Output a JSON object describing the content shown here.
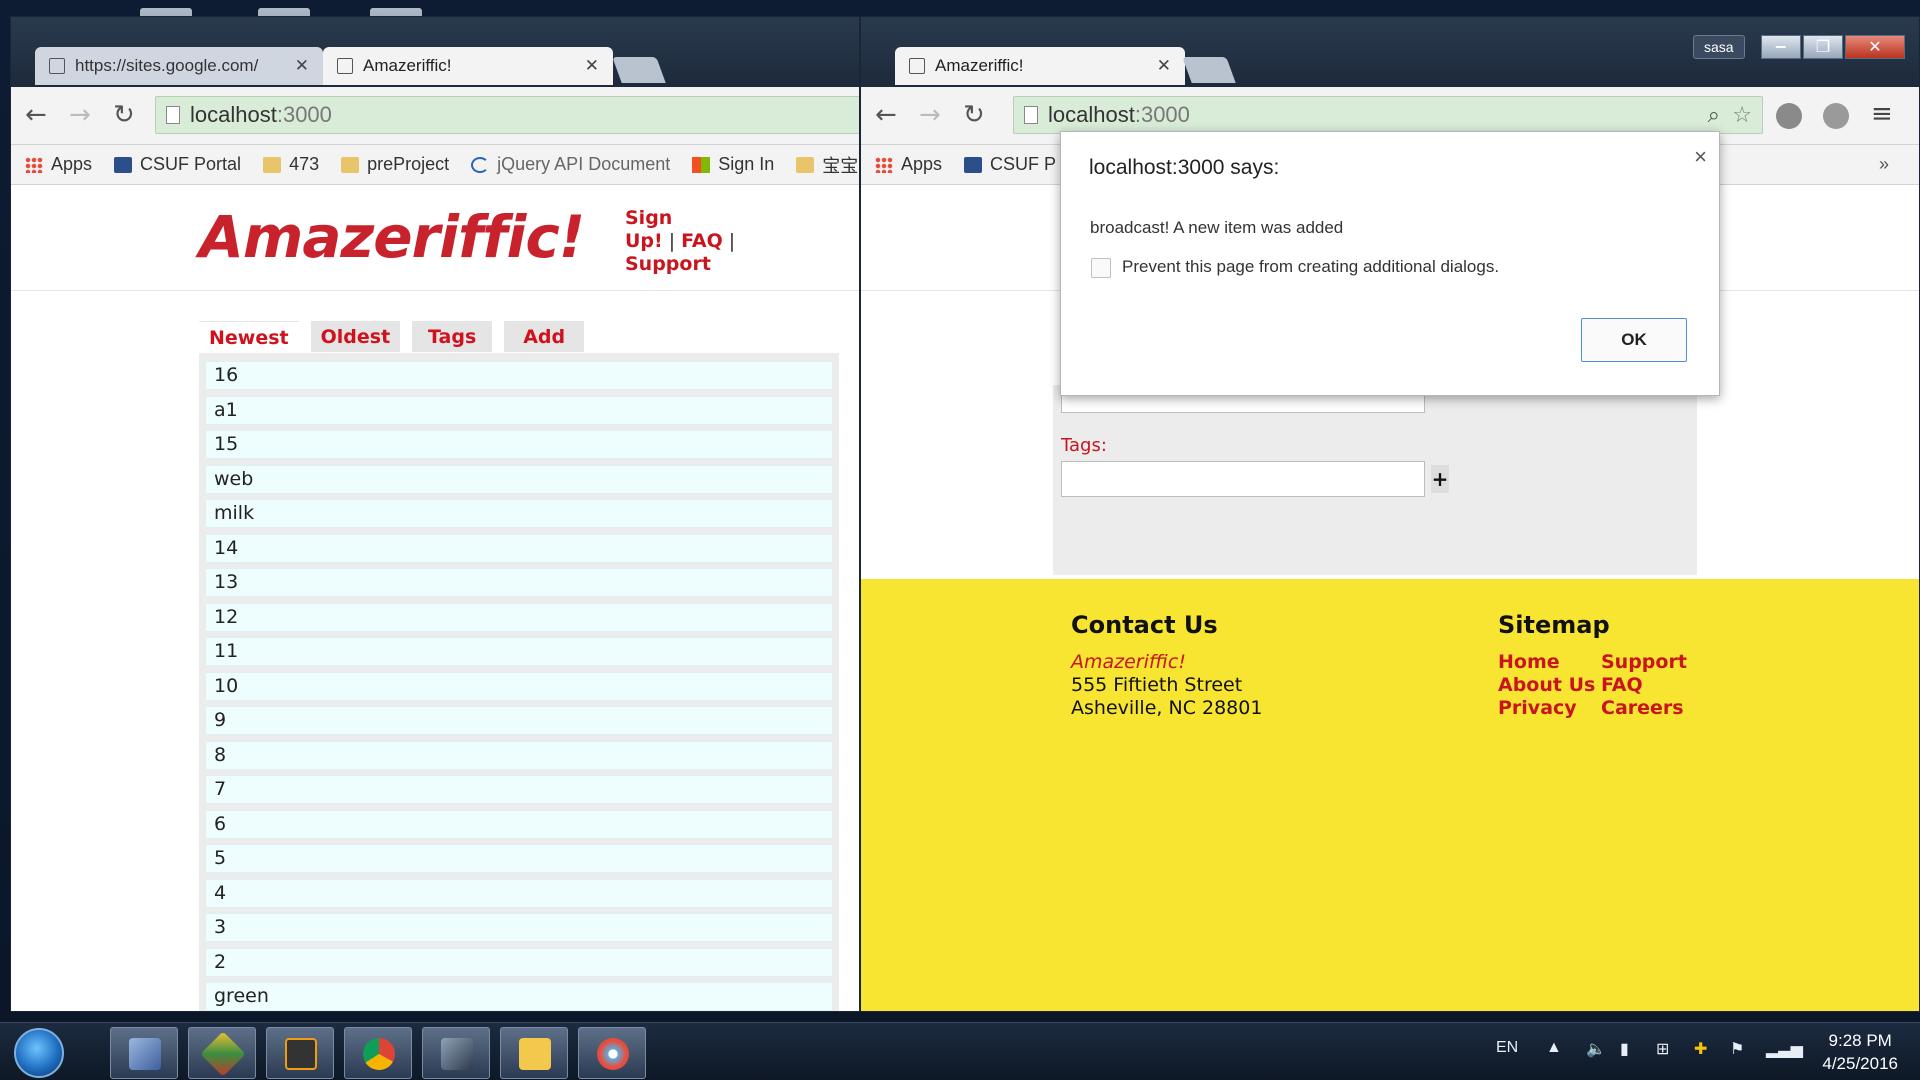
{
  "left_window": {
    "tabs": [
      {
        "title": "https://sites.google.com/",
        "active": false
      },
      {
        "title": "Amazeriffic!",
        "active": true
      }
    ],
    "url_host": "localhost",
    "url_port": ":3000",
    "bookmarks": [
      "Apps",
      "CSUF Portal",
      "473",
      "preProject",
      "jQuery API Document",
      "Sign In",
      "宝宝"
    ],
    "site": {
      "logo": "Amazeriffic!",
      "nav": {
        "signup": "Sign Up!",
        "faq": "FAQ",
        "support": "Support",
        "sep": "|"
      },
      "tabs": [
        "Newest",
        "Oldest",
        "Tags",
        "Add"
      ],
      "items": [
        "16",
        "a1",
        "15",
        "web",
        "milk",
        "14",
        "13",
        "12",
        "11",
        "10",
        "9",
        "8",
        "7",
        "6",
        "5",
        "4",
        "3",
        "2",
        "green"
      ]
    }
  },
  "right_window": {
    "tab_title": "Amazeriffic!",
    "url_host": "localhost",
    "url_port": ":3000",
    "bookmarks": [
      "Apps",
      "CSUF P"
    ],
    "user": "sasa",
    "form": {
      "tags_label": "Tags:",
      "plus": "+"
    },
    "footer": {
      "contact_heading": "Contact Us",
      "company": "Amazeriffic!",
      "address1": "555 Fiftieth Street",
      "address2": "Asheville, NC 28801",
      "sitemap_heading": "Sitemap",
      "links_col1": [
        "Home",
        "About Us",
        "Privacy"
      ],
      "links_col2": [
        "Support",
        "FAQ",
        "Careers"
      ]
    }
  },
  "dialog": {
    "title": "localhost:3000 says:",
    "message": "broadcast! A new item was added",
    "checkbox_label": "Prevent this page from creating additional dialogs.",
    "ok_label": "OK",
    "close": "×"
  },
  "taskbar": {
    "language": "EN",
    "time": "9:28 PM",
    "date": "4/25/2016",
    "apps": [
      "virtualbox",
      "git",
      "sublime",
      "chrome",
      "network-tool",
      "file-explorer",
      "paint"
    ]
  },
  "colors": {
    "brand_red": "#c8151e",
    "footer_yellow": "#f7e532",
    "list_bg": "#eefdfd"
  }
}
